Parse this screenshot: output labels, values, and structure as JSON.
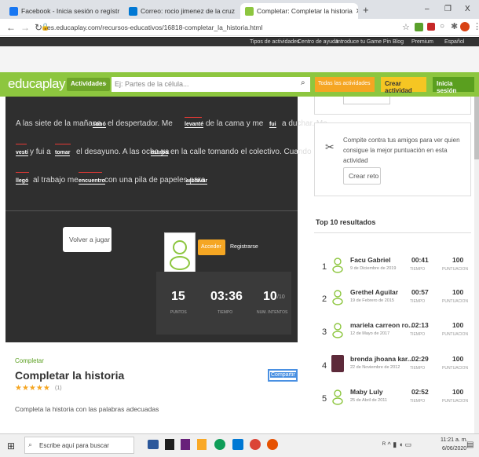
{
  "browser": {
    "tabs": [
      {
        "title": "Facebook - Inicia sesión o regístr",
        "color": "#1877f2"
      },
      {
        "title": "Correo: rocio jimenez de la cruz",
        "color": "#0078d4"
      },
      {
        "title": "Completar: Completar la historia",
        "color": "#8dc63f"
      }
    ],
    "new_tab": "+",
    "url": "es.educaplay.com/recursos-educativos/16818-completar_la_historia.html",
    "window_controls": [
      "–",
      "❐",
      "X"
    ]
  },
  "site_top": {
    "links": [
      "Tipos de actividades",
      "Centro de ayuda",
      "Introduce tu Game Pin",
      "Blog",
      "Premium",
      "Español"
    ]
  },
  "header": {
    "logo": "educaplay",
    "activities_label": "Actividades",
    "search_placeholder": "Ej: Partes de la célula...",
    "all_activities": "Todas las actividades",
    "create_activity": "Crear actividad",
    "login": "Inicia sesión"
  },
  "game": {
    "line1": [
      "A las siete de la mañana",
      "sonó",
      "el despertador. Me",
      "levanté",
      "de la cama y me",
      "fui",
      "a duchar. Me"
    ],
    "line2": [
      "vestí",
      "y fui a",
      "tomar",
      "el desayuno. A las ocho ya",
      "estaba",
      "en la calle tomando el colectivo. Cuando"
    ],
    "line3": [
      "llegó",
      "al trabajo me",
      "encuentro",
      "con una pila de papeles para",
      "archivar"
    ],
    "replay": "Volver a jugar",
    "access": "Acceder",
    "register": "Registrarse",
    "points": "15",
    "points_label": "PUNTOS",
    "time": "03:36",
    "time_label": "TIEMPO",
    "attempts": "10",
    "attempts_suffix": "/10",
    "attempts_label": "NUM. INTENTOS"
  },
  "activity": {
    "type": "Completar",
    "title": "Completar la historia",
    "stars": "★★★★★",
    "rating_count": "(1)",
    "description": "Completa la historia con las palabras adecuadas",
    "share": "Compartir"
  },
  "challenge": {
    "text1": "Compite contra tus amigos para ver quien",
    "text2": "consigue la mejor puntuación en esta actividad",
    "button": "Crear reto"
  },
  "top10": {
    "title": "Top 10 resultados",
    "time_label": "TIEMPO",
    "score_label": "PUNTUACION",
    "rows": [
      {
        "rank": "1",
        "name": "Facu Gabriel",
        "date": "9 de Diciembre de 2019",
        "time": "00:41",
        "score": "100"
      },
      {
        "rank": "2",
        "name": "Grethel Aguilar",
        "date": "19 de Febrero de 2015",
        "time": "00:57",
        "score": "100"
      },
      {
        "rank": "3",
        "name": "mariela carreon ro...",
        "date": "12 de Mayo de 2017",
        "time": "02:13",
        "score": "100"
      },
      {
        "rank": "4",
        "name": "brenda jhoana kar...",
        "date": "22 de Noviembre de 2012",
        "time": "02:29",
        "score": "100"
      },
      {
        "rank": "5",
        "name": "Maby Luly",
        "date": "25 de Abril de 2011",
        "time": "02:52",
        "score": "100"
      }
    ]
  },
  "taskbar": {
    "search_placeholder": "Escribe aquí para buscar",
    "time": "11:21 a. m.",
    "date": "6/06/2020"
  }
}
